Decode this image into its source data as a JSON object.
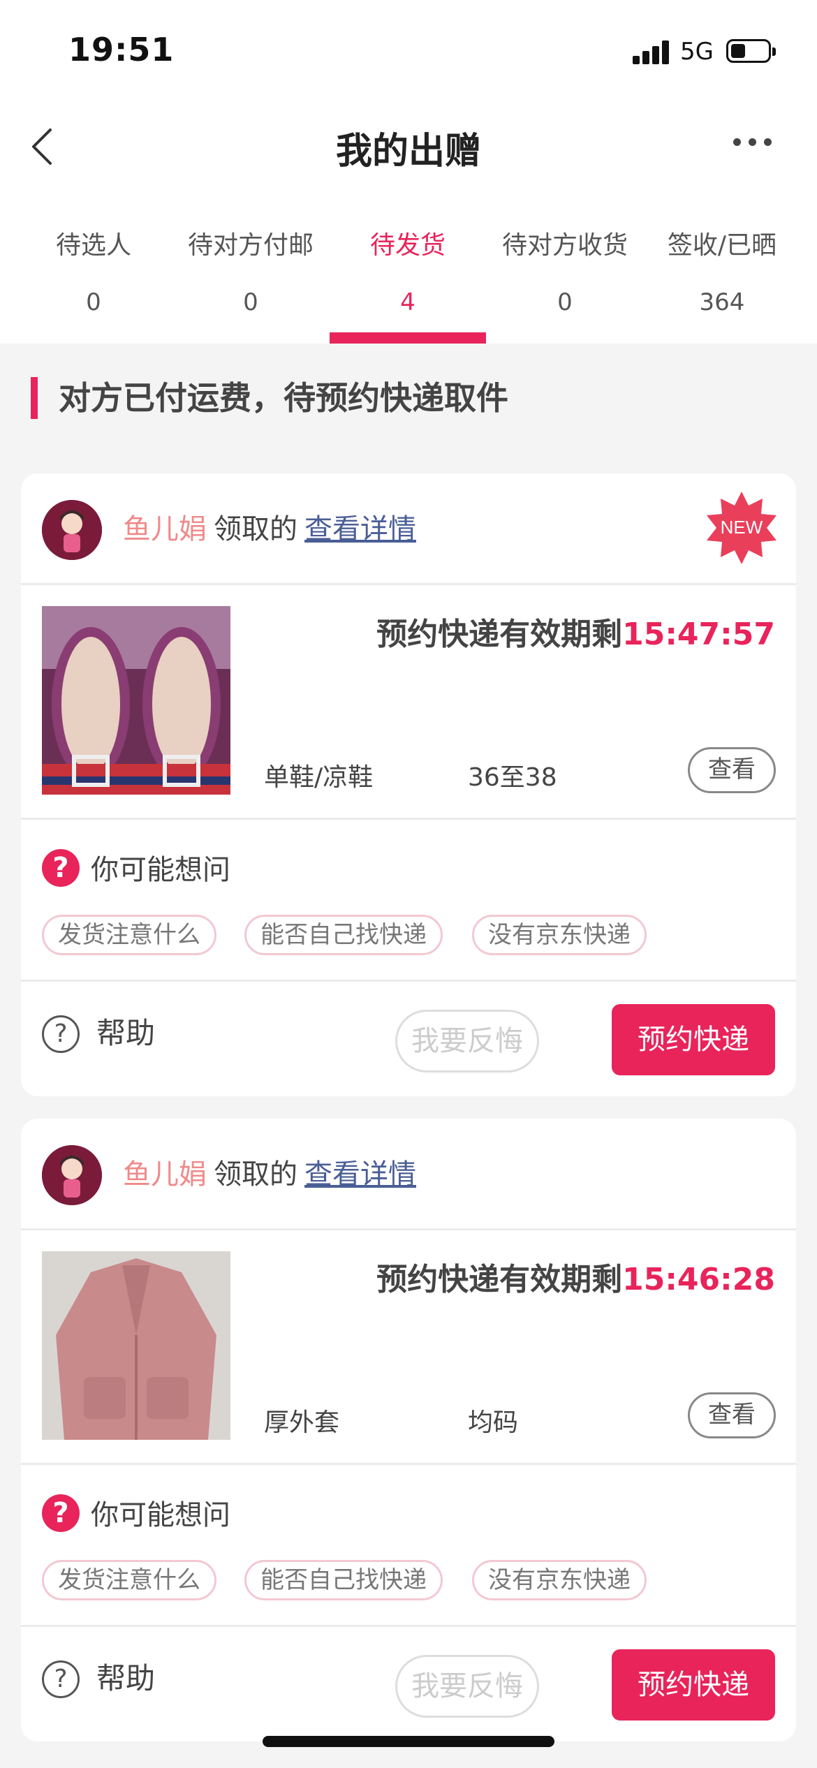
{
  "status": {
    "time": "19:51",
    "network": "5G"
  },
  "nav": {
    "title": "我的出赠"
  },
  "tabs": [
    {
      "label": "待选人",
      "count": "0"
    },
    {
      "label": "待对方付邮",
      "count": "0"
    },
    {
      "label": "待发货",
      "count": "4"
    },
    {
      "label": "待对方收货",
      "count": "0"
    },
    {
      "label": "签收/已晒",
      "count": "364"
    }
  ],
  "section": {
    "title": "对方已付运费，待预约快递取件"
  },
  "cards": [
    {
      "user": "鱼儿娟",
      "claimed": "领取的",
      "details_link": "查看详情",
      "new_badge": "NEW",
      "deadline_label": "预约快递有效期剩",
      "countdown": "15:47:57",
      "category": "单鞋/凉鞋",
      "size": "36至38",
      "view_label": "查看",
      "faq_title": "你可能想问",
      "chips": [
        "发货注意什么",
        "能否自己找快递",
        "没有京东快递"
      ],
      "help_label": "帮助",
      "regret_label": "我要反悔",
      "book_label": "预约快递"
    },
    {
      "user": "鱼儿娟",
      "claimed": "领取的",
      "details_link": "查看详情",
      "deadline_label": "预约快递有效期剩",
      "countdown": "15:46:28",
      "category": "厚外套",
      "size": "均码",
      "view_label": "查看",
      "faq_title": "你可能想问",
      "chips": [
        "发货注意什么",
        "能否自己找快递",
        "没有京东快递"
      ],
      "help_label": "帮助",
      "regret_label": "我要反悔",
      "book_label": "预约快递"
    }
  ],
  "colors": {
    "accent": "#e8245b",
    "link": "#4a5e96",
    "username": "#ef8a8a"
  }
}
